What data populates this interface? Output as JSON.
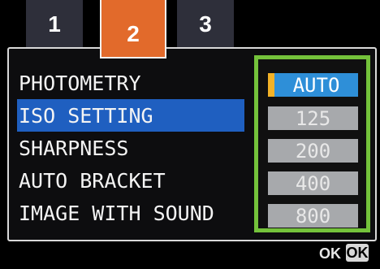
{
  "tabs": [
    {
      "label": "1"
    },
    {
      "label": "2"
    },
    {
      "label": "3"
    }
  ],
  "menu": {
    "items": [
      {
        "label": "PHOTOMETRY"
      },
      {
        "label": "ISO SETTING"
      },
      {
        "label": "SHARPNESS"
      },
      {
        "label": "AUTO BRACKET"
      },
      {
        "label": "IMAGE WITH SOUND"
      }
    ],
    "selected_item": "ISO SETTING"
  },
  "options": {
    "values": [
      {
        "label": "AUTO"
      },
      {
        "label": "125"
      },
      {
        "label": "200"
      },
      {
        "label": "400"
      },
      {
        "label": "800"
      }
    ],
    "selected_value": "AUTO"
  },
  "footer": {
    "ok_text": "OK",
    "ok_key": "OK"
  },
  "colors": {
    "active_tab": "#e26a2b",
    "tab": "#2e2f3a",
    "selected_row": "#1f5fc0",
    "options_border": "#74c23b",
    "active_option": "#2e8fd8",
    "option_marker": "#f2b227",
    "option": "#a7a9ac"
  }
}
